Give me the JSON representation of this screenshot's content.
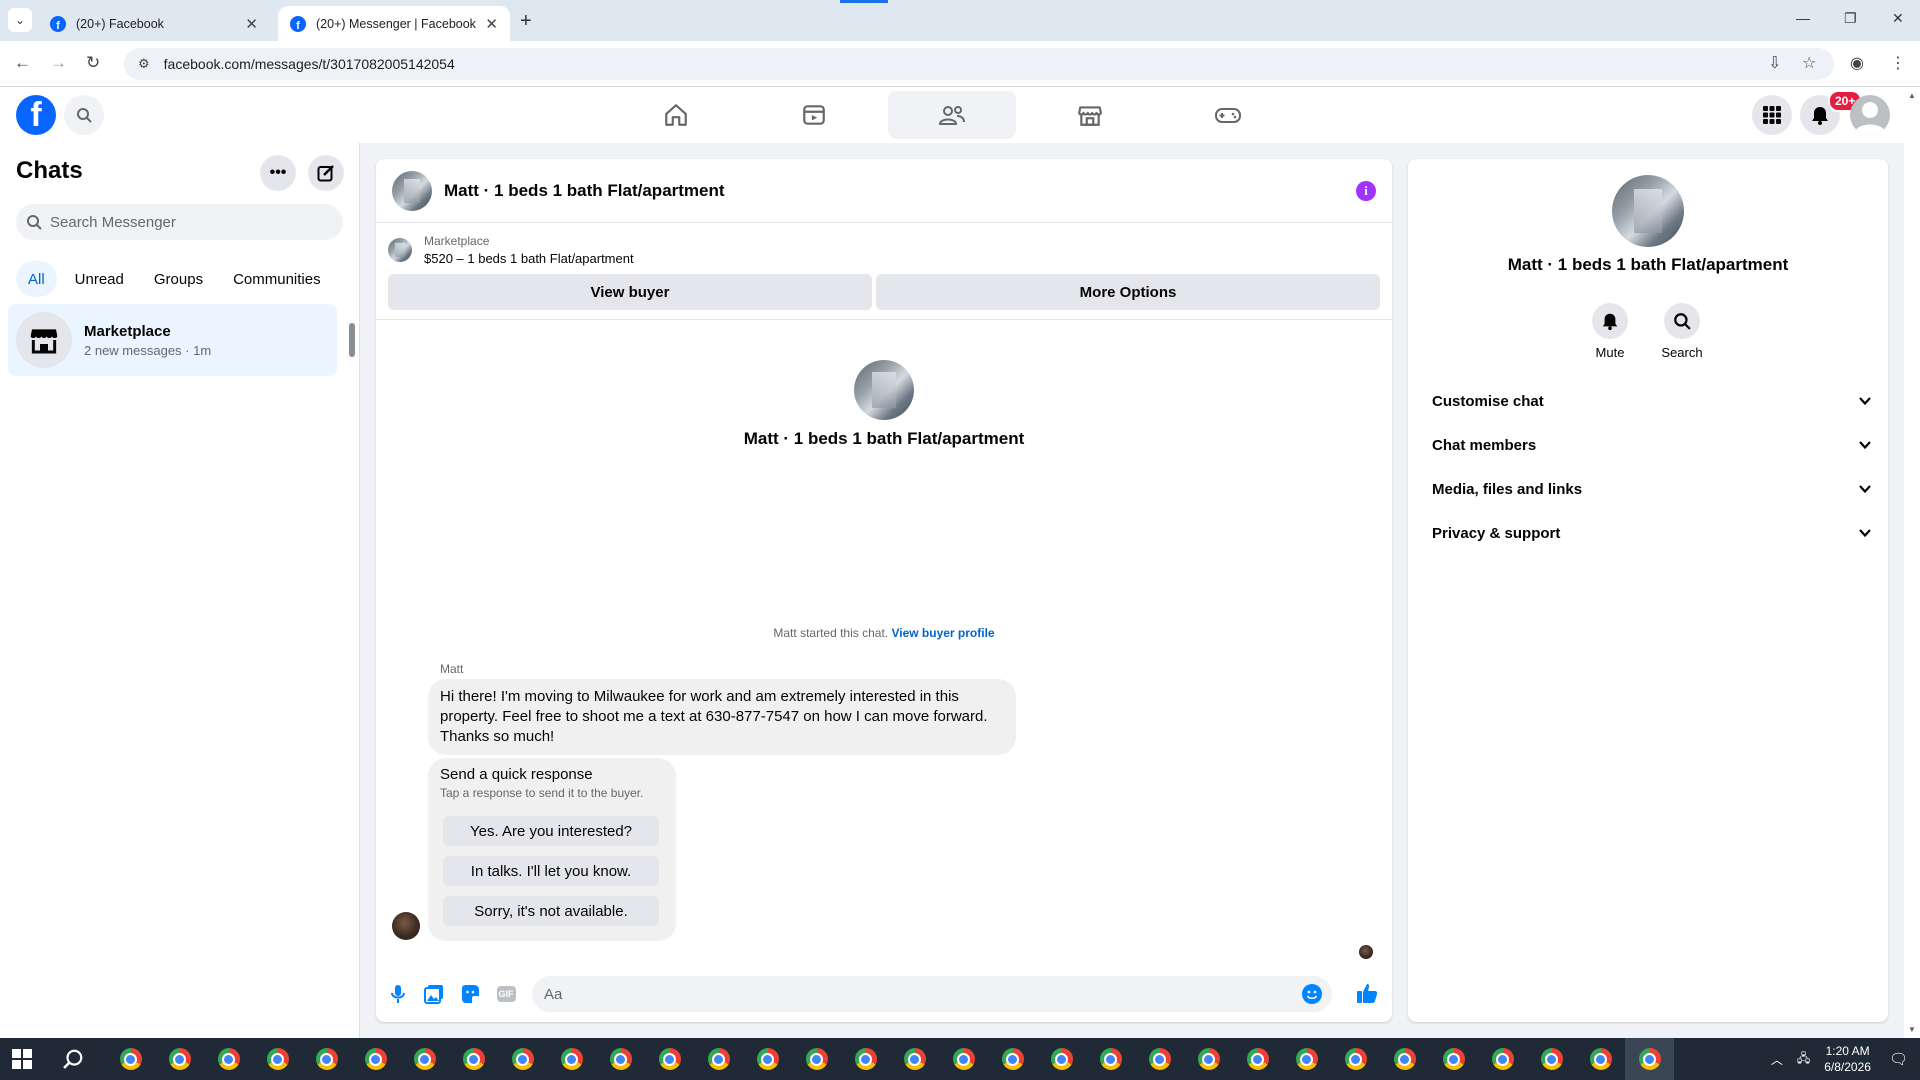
{
  "browser": {
    "tabs": [
      {
        "title": "(20+) Facebook",
        "active": false
      },
      {
        "title": "(20+) Messenger | Facebook",
        "active": true
      }
    ],
    "url": "facebook.com/messages/t/3017082005142054"
  },
  "header": {
    "logo_letter": "f",
    "notifications_badge": "20+",
    "nav_tabs": [
      "home",
      "video",
      "friends",
      "marketplace",
      "gaming"
    ],
    "selected_nav": "friends"
  },
  "sidebar": {
    "title": "Chats",
    "search_placeholder": "Search Messenger",
    "filters": [
      "All",
      "Unread",
      "Groups",
      "Communities"
    ],
    "selected_filter": "All",
    "chats": [
      {
        "name": "Marketplace",
        "subtitle": "2 new messages · 1m"
      }
    ]
  },
  "conversation": {
    "title": "Matt · 1 beds 1 bath Flat/apartment",
    "listing": {
      "source": "Marketplace",
      "title": "$520 – 1 beds 1 bath Flat/apartment"
    },
    "buttons": {
      "view_buyer": "View buyer",
      "more_options": "More Options"
    },
    "intro_name": "Matt · 1 beds 1 bath Flat/apartment",
    "started_text": "Matt started this chat.",
    "started_link": "View buyer profile",
    "sender": "Matt",
    "message": "Hi there! I'm moving to Milwaukee for work and am extremely interested in this property. Feel free to shoot me a text at 630-877-7547 on how I can move forward. Thanks so much!",
    "quick_response": {
      "title": "Send a quick response",
      "subtitle": "Tap a response to send it to the buyer.",
      "options": [
        "Yes. Are you interested?",
        "In talks. I'll let you know.",
        "Sorry, it's not available."
      ]
    },
    "composer_placeholder": "Aa",
    "accent_color": "#0084ff"
  },
  "details": {
    "name": "Matt · 1 beds 1 bath Flat/apartment",
    "actions": [
      {
        "label": "Mute",
        "icon": "bell-icon"
      },
      {
        "label": "Search",
        "icon": "search-icon"
      }
    ],
    "sections": [
      "Customise chat",
      "Chat members",
      "Media, files and links",
      "Privacy & support"
    ]
  },
  "taskbar": {
    "time": "1:20 AM",
    "date": "6/8/2026"
  }
}
